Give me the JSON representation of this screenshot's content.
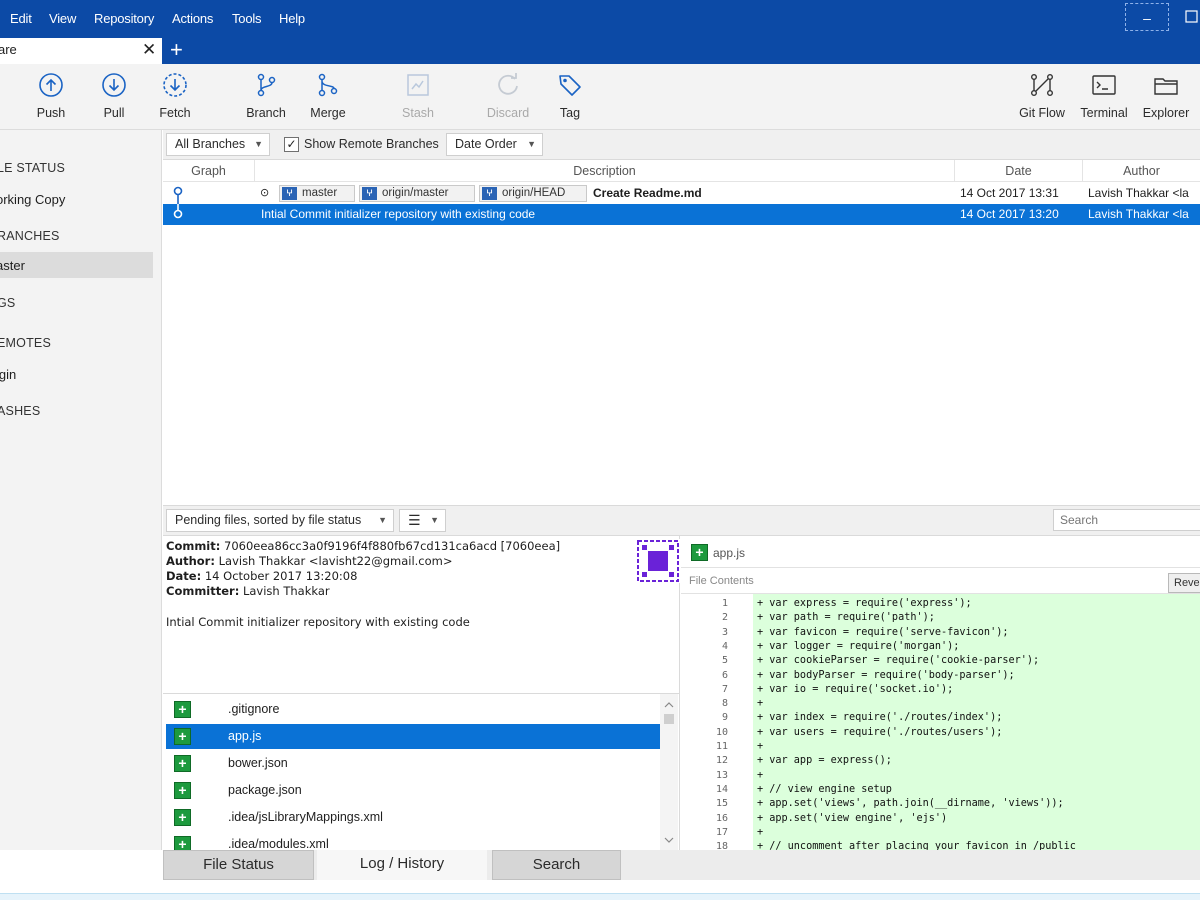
{
  "menu": [
    "Edit",
    "View",
    "Repository",
    "Actions",
    "Tools",
    "Help"
  ],
  "window": {
    "minimize": "–"
  },
  "tab": {
    "title": "are",
    "close": "✕",
    "add": "+"
  },
  "toolbar": {
    "push": "Push",
    "pull": "Pull",
    "fetch": "Fetch",
    "branch": "Branch",
    "merge": "Merge",
    "stash": "Stash",
    "discard": "Discard",
    "tag": "Tag",
    "gitflow": "Git Flow",
    "terminal": "Terminal",
    "explorer": "Explorer"
  },
  "sidebar": {
    "file_status": "LE STATUS",
    "working_copy": "orking Copy",
    "branches": "RANCHES",
    "master": "aster",
    "tags": "GS",
    "remotes": "EMOTES",
    "origin": "igin",
    "stashes": "ASHES"
  },
  "filters": {
    "branches": "All Branches",
    "show_remote": "Show Remote Branches",
    "order": "Date Order",
    "show_remote_checked": true
  },
  "log": {
    "columns": [
      "Graph",
      "Description",
      "Date",
      "Author"
    ],
    "rows": [
      {
        "refs": [
          "master",
          "origin/master",
          "origin/HEAD"
        ],
        "description": "Create Readme.md",
        "date": "14 Oct 2017 13:31",
        "author": "Lavish Thakkar <la"
      },
      {
        "refs": [],
        "description": "Intial Commit initializer repository with existing code",
        "date": "14 Oct 2017 13:20",
        "author": "Lavish Thakkar <la"
      }
    ]
  },
  "pending": {
    "sort_label": "Pending files, sorted by file status",
    "search_placeholder": "Search"
  },
  "commit": {
    "commit_label": "Commit:",
    "commit_value": "7060eea86cc3a0f9196f4f880fb67cd131ca6acd [7060eea]",
    "author_label": "Author:",
    "author_value": "Lavish Thakkar <lavisht22@gmail.com>",
    "date_label": "Date:",
    "date_value": "14 October 2017 13:20:08",
    "committer_label": "Committer:",
    "committer_value": "Lavish Thakkar",
    "message": "Intial Commit initializer repository with existing code"
  },
  "files": [
    ".gitignore",
    "app.js",
    "bower.json",
    "package.json",
    ".idea/jsLibraryMappings.xml",
    ".idea/modules.xml"
  ],
  "diff": {
    "file": "app.js",
    "section": "File Contents",
    "revert": "Rever",
    "lines": [
      "+ var express = require('express');",
      "+ var path = require('path');",
      "+ var favicon = require('serve-favicon');",
      "+ var logger = require('morgan');",
      "+ var cookieParser = require('cookie-parser');",
      "+ var bodyParser = require('body-parser');",
      "+ var io = require('socket.io');",
      "+",
      "+ var index = require('./routes/index');",
      "+ var users = require('./routes/users');",
      "+",
      "+ var app = express();",
      "+",
      "+ // view engine setup",
      "+ app.set('views', path.join(__dirname, 'views'));",
      "+ app.set('view engine', 'ejs')",
      "+",
      "+ // uncomment after placing your favicon in /public"
    ],
    "line_numbers": [
      "1",
      "2",
      "3",
      "4",
      "5",
      "6",
      "7",
      "8",
      "9",
      "10",
      "11",
      "12",
      "13",
      "14",
      "15",
      "16",
      "17",
      "18"
    ]
  },
  "bottom_tabs": [
    "File Status",
    "Log / History",
    "Search"
  ],
  "colors": {
    "titlebar": "#0c4aa6",
    "selection": "#0a72d6",
    "added_bg": "#dcffdc",
    "add_icon": "#1d9a3e"
  }
}
